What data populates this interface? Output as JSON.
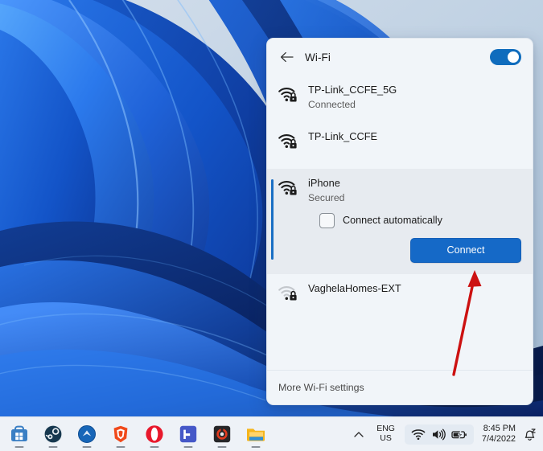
{
  "desktop": {
    "wallpaper_name": "windows-11-bloom-wallpaper"
  },
  "panel": {
    "back_icon": "back-arrow-icon",
    "title": "Wi-Fi",
    "toggle_state": "on",
    "accent_color": "#0f6cbd",
    "background_color": "#f1f5f9",
    "footer_link": "More Wi-Fi settings",
    "networks": [
      {
        "name": "TP-Link_CCFE_5G",
        "status": "Connected",
        "icon": "wifi-secured-full-icon",
        "signal": "full",
        "selected": false
      },
      {
        "name": "TP-Link_CCFE",
        "status": "",
        "icon": "wifi-secured-full-icon",
        "signal": "full",
        "selected": false
      },
      {
        "name": "iPhone",
        "status": "Secured",
        "icon": "wifi-secured-full-icon",
        "signal": "full",
        "selected": true,
        "checkbox_label": "Connect automatically",
        "checkbox_checked": false,
        "connect_label": "Connect",
        "connect_color": "#1569c7"
      },
      {
        "name": "VaghelaHomes-EXT",
        "status": "",
        "icon": "wifi-secured-weak-icon",
        "signal": "weak",
        "selected": false
      }
    ]
  },
  "annotation": {
    "arrow_color": "#cc1111",
    "arrow_name": "red-pointer-arrow"
  },
  "taskbar": {
    "background_color": "#eef2f7",
    "apps": [
      {
        "name": "microsoft-store",
        "running": true
      },
      {
        "name": "steam",
        "running": true
      },
      {
        "name": "blue-circle-app",
        "running": true
      },
      {
        "name": "brave-browser",
        "running": true
      },
      {
        "name": "opera-browser",
        "running": true
      },
      {
        "name": "f-app",
        "running": true
      },
      {
        "name": "dark-ring-app",
        "running": true
      },
      {
        "name": "file-explorer",
        "running": true
      }
    ],
    "tray": {
      "chevron": "show-hidden-icons",
      "language_line1": "ENG",
      "language_line2": "US",
      "network_icon": "wifi-icon",
      "volume_icon": "speaker-icon",
      "battery_icon": "battery-charging-icon",
      "time": "8:45 PM",
      "date": "7/4/2022",
      "notification_icon": "notification-bell-quiet-icon"
    }
  }
}
